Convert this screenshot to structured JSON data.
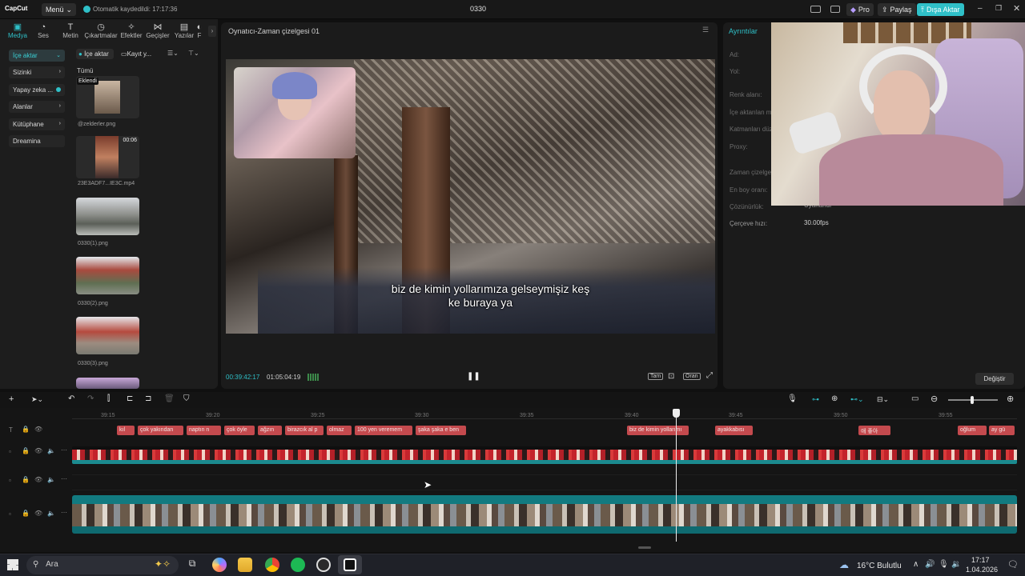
{
  "app": {
    "logo": "CapCut",
    "menu_label": "Menü",
    "autosave": "Otomatik kaydedildi: 17:17:36",
    "project_name": "0330",
    "pro_label": "Pro",
    "share_label": "Paylaş",
    "export_label": "Dışa Aktar",
    "accent": "#2fc0c8"
  },
  "tool_tabs": [
    {
      "label": "Medya",
      "icon": "media-icon"
    },
    {
      "label": "Ses",
      "icon": "audio-icon"
    },
    {
      "label": "Metin",
      "icon": "text-icon"
    },
    {
      "label": "Çıkartmalar",
      "icon": "sticker-icon"
    },
    {
      "label": "Efektler",
      "icon": "effects-icon"
    },
    {
      "label": "Geçişler",
      "icon": "transitions-icon"
    },
    {
      "label": "Yazılar",
      "icon": "captions-icon"
    },
    {
      "label": "F",
      "icon": "filter-icon"
    }
  ],
  "left_nav": [
    {
      "label": "İçe aktar"
    },
    {
      "label": "Sizinki"
    },
    {
      "label": "Yapay zeka ..."
    },
    {
      "label": "Alanlar"
    },
    {
      "label": "Kütüphane"
    },
    {
      "label": "Dreamina"
    }
  ],
  "media_toolbar": {
    "import_label": "İçe aktar",
    "record_label": "Kayıt y...",
    "filter_label": "Tümü"
  },
  "media_items": [
    {
      "name": "@zelderler.png",
      "badge": "Eklendi",
      "duration": ""
    },
    {
      "name": "23E3ADF7...IE3C.mp4",
      "badge": "",
      "duration": "00:06"
    },
    {
      "name": "0330(1).png",
      "badge": "",
      "duration": ""
    },
    {
      "name": "0330(2).png",
      "badge": "",
      "duration": ""
    },
    {
      "name": "0330(3).png",
      "badge": "",
      "duration": ""
    }
  ],
  "viewer": {
    "title": "Oynatıcı-Zaman çizelgesi 01",
    "subtitle_line1": "biz de kimin yollarımıza gelseymişiz keş",
    "subtitle_line2": "ke buraya ya",
    "current_time": "00:39:42:17",
    "total_time": "01:05:04:19",
    "full_label": "Tam",
    "ratio_label": "Oran"
  },
  "details": {
    "title": "Ayrıntılar",
    "labels": [
      "Ad:",
      "Yol:",
      "Renk alanı:",
      "İçe aktarılan m...",
      "Katmanları düz...",
      "Proxy:",
      "Zaman çizelgesi...",
      "En boy oranı:",
      "Çözünürlük:",
      "Çerçeve hızı:"
    ],
    "resolution_value": "Uyarlandı",
    "framerate_value": "30.00fps",
    "change_label": "Değiştir"
  },
  "timeline": {
    "ruler": [
      "39:15",
      "39:20",
      "39:25",
      "39:30",
      "39:35",
      "39:40",
      "39:45",
      "39:50",
      "39:55"
    ],
    "subtitles": [
      {
        "text": "kıl"
      },
      {
        "text": "çok yakından"
      },
      {
        "text": "naptın n"
      },
      {
        "text": "çok öyle"
      },
      {
        "text": "ağzın"
      },
      {
        "text": "birazcık al p"
      },
      {
        "text": "olmaz"
      },
      {
        "text": "100 yen veremem"
      },
      {
        "text": "şaka şaka e ben"
      },
      {
        "text": "biz de kimin yollarımı"
      },
      {
        "text": "ayakkabısı"
      },
      {
        "text": "애 좋아"
      },
      {
        "text": "oğlum"
      },
      {
        "text": "ay gü"
      }
    ]
  },
  "taskbar": {
    "search_placeholder": "Ara",
    "weather": "16°C Bulutlu",
    "time": "17:17",
    "date": "1.04.2026"
  }
}
